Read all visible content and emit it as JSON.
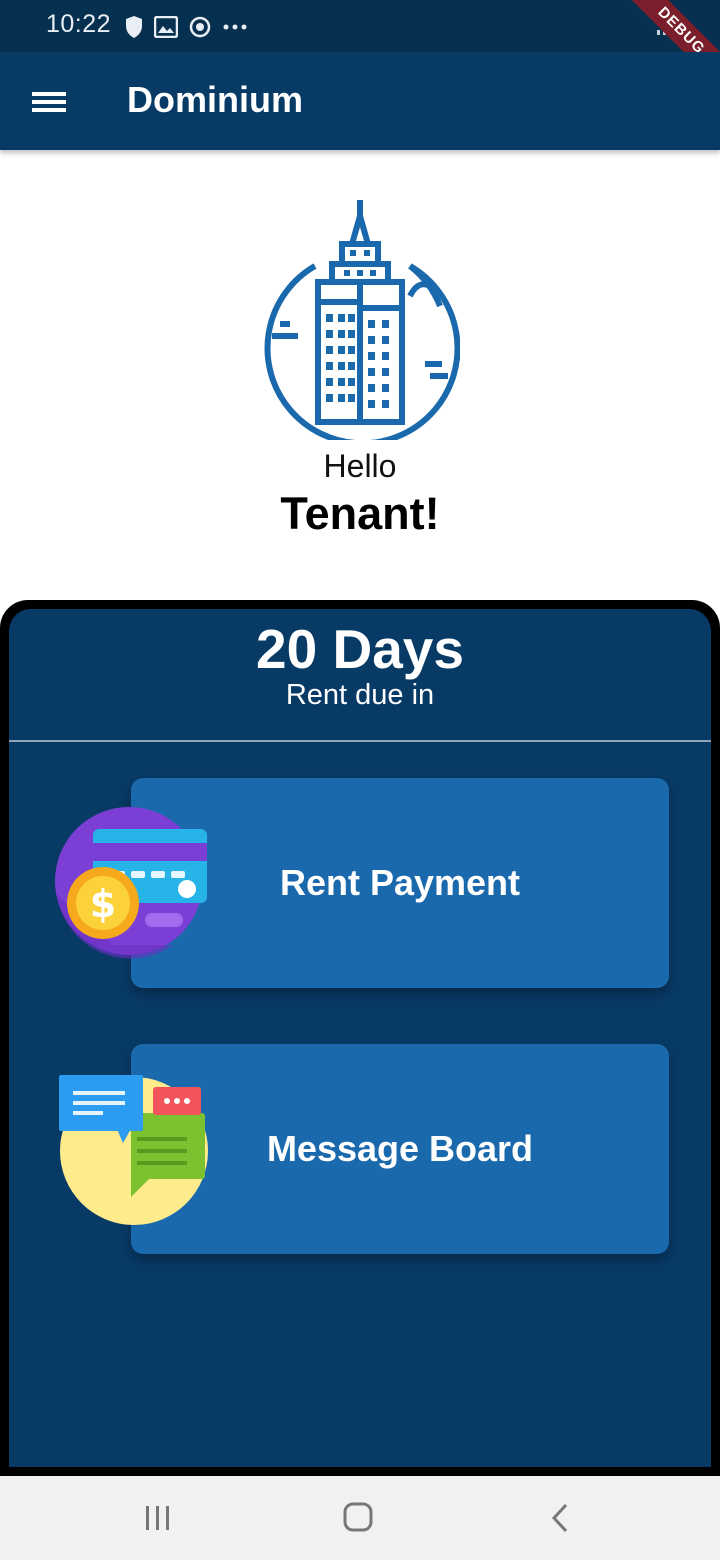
{
  "status_bar": {
    "time": "10:22",
    "icons": [
      "shield-icon",
      "image-icon",
      "sync-icon",
      "more-dots-icon"
    ],
    "right_icons": [
      "signal-icon",
      "battery-icon"
    ],
    "debug_label": "DEBUG"
  },
  "app_bar": {
    "title": "Dominium",
    "menu_icon": "hamburger-menu-icon",
    "background": "#083a66"
  },
  "hero": {
    "logo_icon": "skyscraper-icon",
    "greeting": "Hello",
    "name": "Tenant!"
  },
  "rent_panel": {
    "days": "20 Days",
    "caption": "Rent due in",
    "background": "#083a66"
  },
  "actions": [
    {
      "label": "Rent Payment",
      "icon": "credit-card-coin-icon",
      "background": "#1b69ad"
    },
    {
      "label": "Message Board",
      "icon": "chat-bubbles-icon",
      "background": "#1b69ad"
    }
  ],
  "nav_bar": {
    "buttons": [
      "recent-apps-icon",
      "home-icon",
      "back-icon"
    ]
  }
}
